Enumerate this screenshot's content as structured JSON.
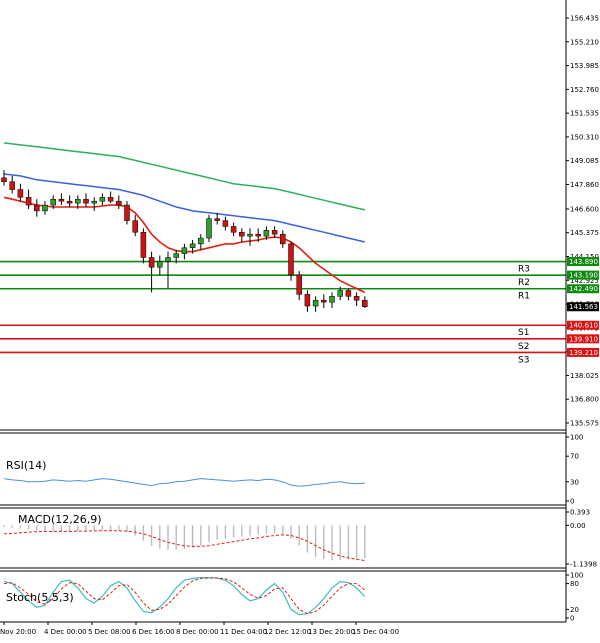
{
  "colors": {
    "background": "#ffffff",
    "axis": "#000000",
    "grid": "#d8d8d8",
    "bull_candle": "#2ca02c",
    "bear_candle": "#cc1414",
    "wick": "#000000",
    "ma_fast": "#e02010",
    "ma_mid": "#3a62d6",
    "ma_slow": "#2fae5f",
    "resistance": "#0f8a0f",
    "support": "#dd1111",
    "price_label": "#000000",
    "indicator_line": "#4a90d9",
    "macd_hist": "#bbbbbb",
    "macd_signal": "#e02010",
    "stoch_k": "#3bbfbf",
    "stoch_d": "#e02010"
  },
  "chart_data": [
    {
      "type": "candlestick",
      "panel": "price",
      "y_ticks": [
        "156.435",
        "155.210",
        "153.985",
        "152.760",
        "151.535",
        "150.310",
        "149.085",
        "147.860",
        "146.600",
        "145.375",
        "144.150",
        "142.925",
        "141.700",
        "140.475",
        "139.250",
        "138.025",
        "136.800",
        "135.575"
      ],
      "ylim": [
        135.575,
        156.435
      ],
      "x_ticks": [
        "Nov 20:00",
        "4 Dec 00:00",
        "5 Dec 08:00",
        "6 Dec 16:00",
        "8 Dec 00:00",
        "11 Dec 04:00",
        "12 Dec 12:00",
        "13 Dec 20:00",
        "15 Dec 04:00"
      ],
      "candles": [
        [
          148.2,
          148.6,
          147.8,
          148.0
        ],
        [
          148.0,
          148.3,
          147.4,
          147.6
        ],
        [
          147.6,
          147.9,
          147.0,
          147.2
        ],
        [
          147.2,
          147.6,
          146.6,
          146.8
        ],
        [
          146.8,
          147.1,
          146.2,
          146.5
        ],
        [
          146.5,
          147.0,
          146.3,
          146.8
        ],
        [
          146.8,
          147.3,
          146.6,
          147.1
        ],
        [
          147.1,
          147.4,
          146.8,
          147.0
        ],
        [
          147.0,
          147.3,
          146.7,
          146.9
        ],
        [
          146.9,
          147.3,
          146.6,
          147.1
        ],
        [
          147.1,
          147.4,
          146.7,
          146.9
        ],
        [
          146.9,
          147.2,
          146.5,
          147.0
        ],
        [
          147.0,
          147.4,
          146.8,
          147.2
        ],
        [
          147.2,
          147.5,
          146.9,
          147.0
        ],
        [
          147.0,
          147.3,
          146.6,
          146.8
        ],
        [
          146.8,
          147.0,
          145.8,
          146.0
        ],
        [
          146.0,
          146.3,
          145.2,
          145.4
        ],
        [
          145.4,
          145.6,
          143.8,
          144.1
        ],
        [
          144.1,
          144.4,
          142.3,
          143.6
        ],
        [
          143.6,
          144.2,
          143.2,
          143.9
        ],
        [
          143.9,
          144.4,
          142.5,
          144.1
        ],
        [
          144.1,
          144.5,
          143.8,
          144.3
        ],
        [
          144.3,
          144.8,
          144.0,
          144.6
        ],
        [
          144.6,
          145.0,
          144.3,
          144.8
        ],
        [
          144.8,
          145.3,
          144.5,
          145.1
        ],
        [
          145.1,
          146.3,
          144.9,
          146.1
        ],
        [
          146.1,
          146.4,
          145.8,
          146.0
        ],
        [
          146.0,
          146.2,
          145.5,
          145.7
        ],
        [
          145.7,
          145.9,
          145.2,
          145.4
        ],
        [
          145.4,
          145.6,
          144.9,
          145.2
        ],
        [
          145.2,
          145.6,
          144.7,
          145.3
        ],
        [
          145.3,
          145.6,
          144.9,
          145.2
        ],
        [
          145.2,
          145.7,
          145.0,
          145.5
        ],
        [
          145.5,
          145.7,
          145.1,
          145.3
        ],
        [
          145.3,
          145.5,
          144.6,
          144.8
        ],
        [
          144.8,
          144.9,
          142.9,
          143.2
        ],
        [
          143.2,
          143.4,
          141.9,
          142.2
        ],
        [
          142.2,
          142.4,
          141.3,
          141.6
        ],
        [
          141.6,
          142.1,
          141.3,
          141.9
        ],
        [
          141.9,
          142.2,
          141.5,
          141.8
        ],
        [
          141.8,
          142.3,
          141.5,
          142.1
        ],
        [
          142.1,
          142.6,
          141.9,
          142.4
        ],
        [
          142.4,
          142.5,
          141.9,
          142.1
        ],
        [
          142.1,
          142.3,
          141.6,
          141.9
        ],
        [
          141.9,
          142.1,
          141.5,
          141.56
        ]
      ],
      "ma_fast": [
        147.2,
        147.1,
        147.0,
        146.9,
        146.8,
        146.75,
        146.7,
        146.7,
        146.7,
        146.7,
        146.7,
        146.7,
        146.75,
        146.8,
        146.8,
        146.7,
        146.4,
        145.9,
        145.3,
        144.9,
        144.6,
        144.45,
        144.4,
        144.4,
        144.5,
        144.6,
        144.7,
        144.8,
        144.8,
        144.9,
        144.95,
        145.0,
        145.1,
        145.15,
        145.1,
        144.9,
        144.6,
        144.2,
        143.8,
        143.5,
        143.2,
        142.9,
        142.7,
        142.5,
        142.3
      ],
      "ma_mid": [
        148.4,
        148.35,
        148.3,
        148.2,
        148.1,
        148.05,
        148.0,
        147.95,
        147.9,
        147.85,
        147.8,
        147.75,
        147.7,
        147.65,
        147.6,
        147.5,
        147.4,
        147.3,
        147.15,
        147.0,
        146.85,
        146.7,
        146.6,
        146.5,
        146.45,
        146.4,
        146.35,
        146.3,
        146.25,
        146.2,
        146.15,
        146.1,
        146.05,
        146.0,
        145.9,
        145.8,
        145.7,
        145.6,
        145.5,
        145.4,
        145.3,
        145.2,
        145.1,
        145.0,
        144.9
      ],
      "ma_slow": [
        150.0,
        149.95,
        149.9,
        149.85,
        149.8,
        149.75,
        149.7,
        149.65,
        149.6,
        149.55,
        149.5,
        149.45,
        149.4,
        149.35,
        149.3,
        149.2,
        149.1,
        149.0,
        148.9,
        148.8,
        148.7,
        148.6,
        148.5,
        148.4,
        148.3,
        148.2,
        148.1,
        148.0,
        147.9,
        147.85,
        147.8,
        147.75,
        147.7,
        147.65,
        147.55,
        147.45,
        147.35,
        147.25,
        147.15,
        147.05,
        146.95,
        146.85,
        146.75,
        146.65,
        146.55
      ],
      "levels": [
        {
          "name": "R3",
          "value": 143.89,
          "label": "143.890",
          "kind": "resistance"
        },
        {
          "name": "R2",
          "value": 143.19,
          "label": "143.190",
          "kind": "resistance"
        },
        {
          "name": "R1",
          "value": 142.49,
          "label": "142.490",
          "kind": "resistance"
        },
        {
          "name": "S1",
          "value": 140.61,
          "label": "140.610",
          "kind": "support"
        },
        {
          "name": "S2",
          "value": 139.91,
          "label": "139.910",
          "kind": "support"
        },
        {
          "name": "S3",
          "value": 139.21,
          "label": "139.210",
          "kind": "support"
        }
      ],
      "current_price": {
        "value": 141.563,
        "label": "141.563"
      }
    },
    {
      "type": "line",
      "panel": "rsi",
      "title": "RSI(14)",
      "y_ticks": [
        "100",
        "70",
        "30",
        "0"
      ],
      "ylim": [
        0,
        100
      ],
      "series": [
        {
          "values": [
            35,
            33,
            32,
            30,
            30,
            31,
            33,
            32,
            31,
            32,
            31,
            33,
            35,
            34,
            32,
            30,
            28,
            26,
            24,
            27,
            28,
            30,
            31,
            33,
            35,
            34,
            33,
            32,
            31,
            32,
            33,
            32,
            34,
            33,
            30,
            25,
            23,
            24,
            26,
            27,
            29,
            30,
            28,
            27,
            28
          ]
        }
      ]
    },
    {
      "type": "bar+line",
      "panel": "macd",
      "title": "MACD(12,26,9)",
      "y_ticks": [
        "0.393",
        "0.00",
        "-1.1398"
      ],
      "ylim": [
        -1.1398,
        0.393
      ],
      "histogram": [
        -0.05,
        -0.08,
        -0.1,
        -0.12,
        -0.15,
        -0.17,
        -0.18,
        -0.18,
        -0.17,
        -0.17,
        -0.16,
        -0.15,
        -0.14,
        -0.14,
        -0.15,
        -0.2,
        -0.3,
        -0.45,
        -0.6,
        -0.68,
        -0.72,
        -0.72,
        -0.7,
        -0.66,
        -0.6,
        -0.5,
        -0.42,
        -0.38,
        -0.36,
        -0.33,
        -0.3,
        -0.27,
        -0.24,
        -0.22,
        -0.25,
        -0.4,
        -0.6,
        -0.8,
        -0.93,
        -1.0,
        -1.03,
        -1.02,
        -1.0,
        -0.98,
        -0.97
      ],
      "signal": [
        -0.25,
        -0.24,
        -0.22,
        -0.2,
        -0.19,
        -0.18,
        -0.18,
        -0.18,
        -0.18,
        -0.17,
        -0.17,
        -0.16,
        -0.16,
        -0.16,
        -0.16,
        -0.17,
        -0.2,
        -0.25,
        -0.33,
        -0.42,
        -0.5,
        -0.56,
        -0.6,
        -0.62,
        -0.62,
        -0.6,
        -0.56,
        -0.52,
        -0.48,
        -0.44,
        -0.4,
        -0.37,
        -0.33,
        -0.3,
        -0.28,
        -0.3,
        -0.37,
        -0.47,
        -0.6,
        -0.72,
        -0.82,
        -0.9,
        -0.96,
        -1.0,
        -1.04
      ]
    },
    {
      "type": "line",
      "panel": "stoch",
      "title": "Stoch(5,5,3)",
      "y_ticks": [
        "100",
        "80",
        "20",
        "0"
      ],
      "ylim": [
        0,
        100
      ],
      "series": [
        {
          "values": [
            85,
            80,
            60,
            40,
            25,
            30,
            60,
            85,
            88,
            70,
            45,
            35,
            50,
            75,
            85,
            70,
            40,
            15,
            12,
            25,
            45,
            70,
            88,
            92,
            94,
            94,
            93,
            88,
            75,
            55,
            40,
            45,
            65,
            80,
            60,
            20,
            8,
            10,
            25,
            45,
            70,
            85,
            82,
            70,
            50
          ]
        },
        {
          "values": [
            80,
            82,
            70,
            55,
            38,
            32,
            45,
            68,
            82,
            80,
            62,
            45,
            42,
            58,
            75,
            78,
            60,
            35,
            18,
            20,
            32,
            52,
            72,
            86,
            92,
            93,
            93,
            91,
            84,
            70,
            55,
            46,
            52,
            68,
            70,
            45,
            20,
            10,
            15,
            30,
            50,
            70,
            80,
            80,
            65
          ]
        }
      ]
    }
  ]
}
